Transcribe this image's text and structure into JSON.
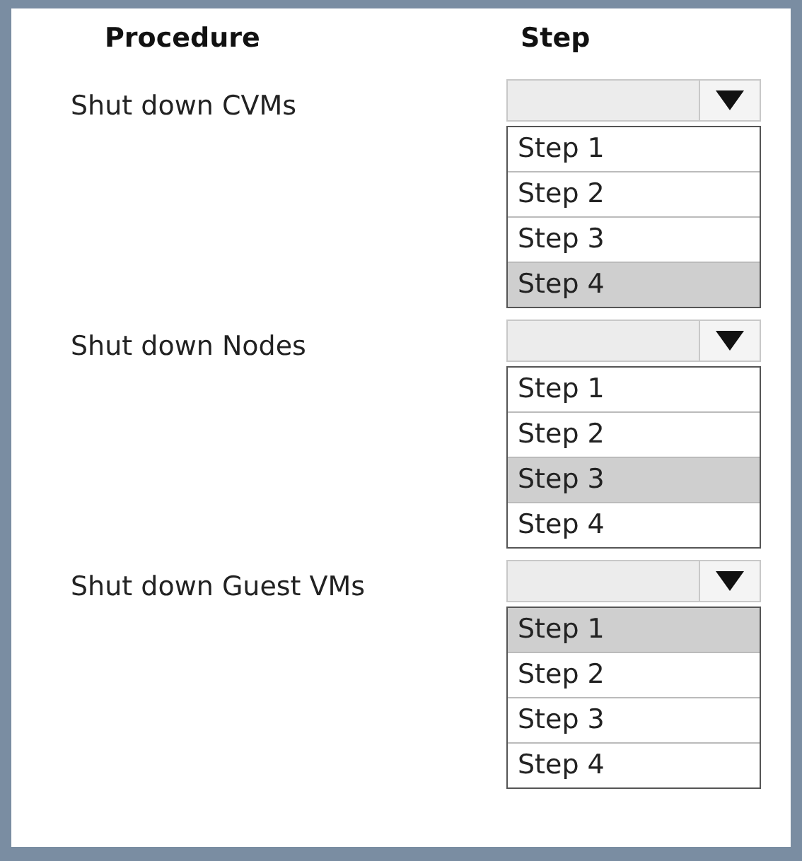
{
  "headers": [
    "Procedure",
    "Step"
  ],
  "rows": [
    {
      "procedure": "Shut down CVMs",
      "options": [
        {
          "label": "Step 1",
          "selected": false
        },
        {
          "label": "Step 2",
          "selected": false
        },
        {
          "label": "Step 3",
          "selected": false
        },
        {
          "label": "Step 4",
          "selected": true
        }
      ]
    },
    {
      "procedure": "Shut down Nodes",
      "options": [
        {
          "label": "Step 1",
          "selected": false
        },
        {
          "label": "Step 2",
          "selected": false
        },
        {
          "label": "Step 3",
          "selected": true
        },
        {
          "label": "Step 4",
          "selected": false
        }
      ]
    },
    {
      "procedure": "Shut down Guest VMs",
      "options": [
        {
          "label": "Step 1",
          "selected": true
        },
        {
          "label": "Step 2",
          "selected": false
        },
        {
          "label": "Step 3",
          "selected": false
        },
        {
          "label": "Step 4",
          "selected": false
        }
      ]
    }
  ]
}
